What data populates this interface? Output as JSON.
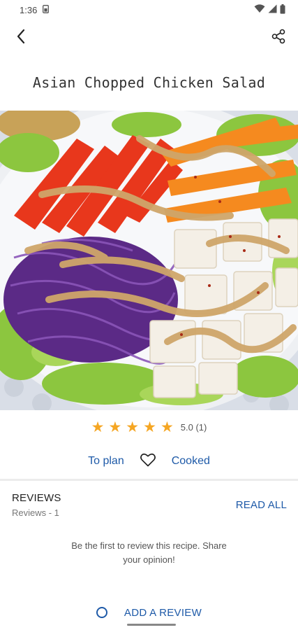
{
  "status_bar": {
    "time": "1:36",
    "icons": [
      "sim-icon",
      "wifi-icon",
      "signal-icon",
      "battery-icon"
    ]
  },
  "app_bar": {
    "back_icon": "back-arrow-icon",
    "share_icon": "share-icon"
  },
  "recipe": {
    "title": "Asian Chopped Chicken Salad",
    "image_alt": "salad-photo"
  },
  "rating": {
    "stars_filled": 5,
    "stars_total": 5,
    "text": "5.0 (1)",
    "star_color": "#f5a623"
  },
  "actions": {
    "plan_label": "To plan",
    "favorite_icon": "heart-outline-icon",
    "cooked_label": "Cooked"
  },
  "reviews": {
    "title": "REVIEWS",
    "count_text": "Reviews - 1",
    "read_all_label": "READ ALL",
    "empty_message": "Be the first to review this recipe. Share your opinion!",
    "add_review_label": "ADD A REVIEW"
  },
  "colors": {
    "accent": "#1e5aa8",
    "star": "#f5a623"
  }
}
